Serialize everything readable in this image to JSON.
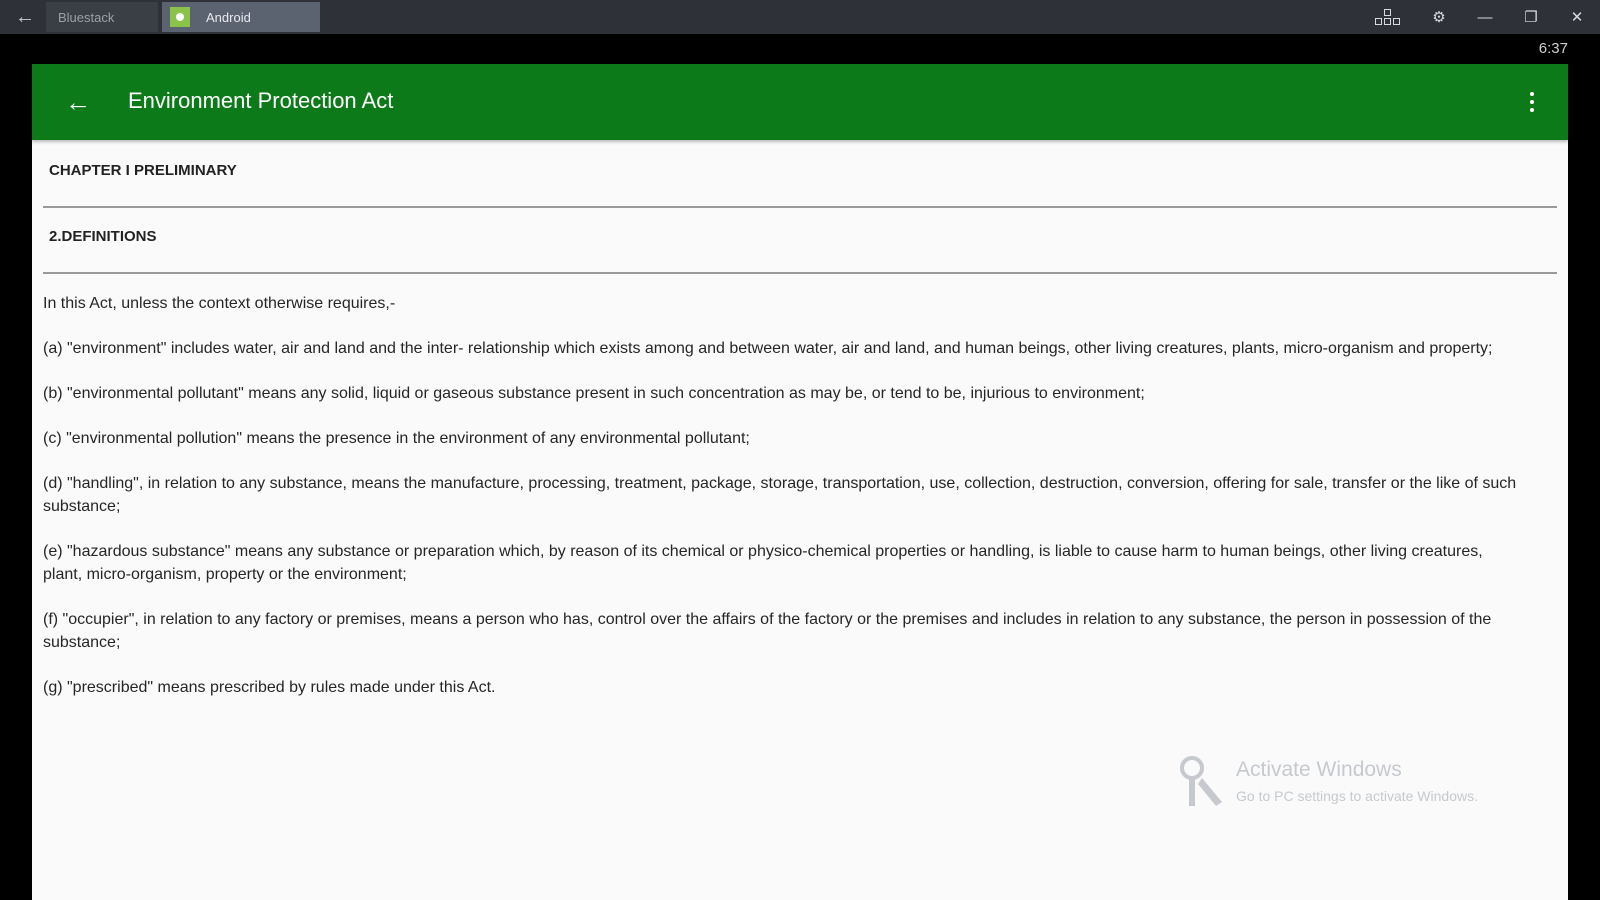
{
  "emulator": {
    "tabs": [
      {
        "label": "Bluestack"
      },
      {
        "label": "Android"
      }
    ]
  },
  "status": {
    "time": "6:37"
  },
  "appbar": {
    "title": "Environment Protection Act"
  },
  "content": {
    "chapter": "CHAPTER I PRELIMINARY",
    "section": "2.DEFINITIONS",
    "paragraphs": [
      "In this Act, unless the context otherwise requires,-",
      "(a) \"environment\" includes water, air and land and the inter- relationship which exists among and between water, air and land, and human beings, other living creatures, plants, micro-organism and property;",
      "(b) \"environmental pollutant\" means any solid, liquid or gaseous substance present in such concentration as may be, or tend to be, injurious to environment;",
      "(c) \"environmental pollution\" means the presence in the environment of any environmental pollutant;",
      "(d) \"handling\", in relation to any substance, means the manufacture, processing, treatment, package, storage, transportation, use, collection, destruction, conversion, offering for sale, transfer or the like of such substance;",
      "(e) \"hazardous substance\" means any substance or preparation which, by reason of its chemical or physico-chemical properties or handling, is liable to cause harm to human beings, other living creatures, plant, micro-organism, property or the environment;",
      "(f) \"occupier\", in relation to any factory or premises, means a person who has, control over the affairs of the factory or the premises and includes in relation to any substance, the person in possession of the substance;",
      "(g) \"prescribed\" means prescribed by rules made under this Act."
    ]
  },
  "watermark": {
    "title": "Activate Windows",
    "subtitle": "Go to PC settings to activate Windows."
  }
}
